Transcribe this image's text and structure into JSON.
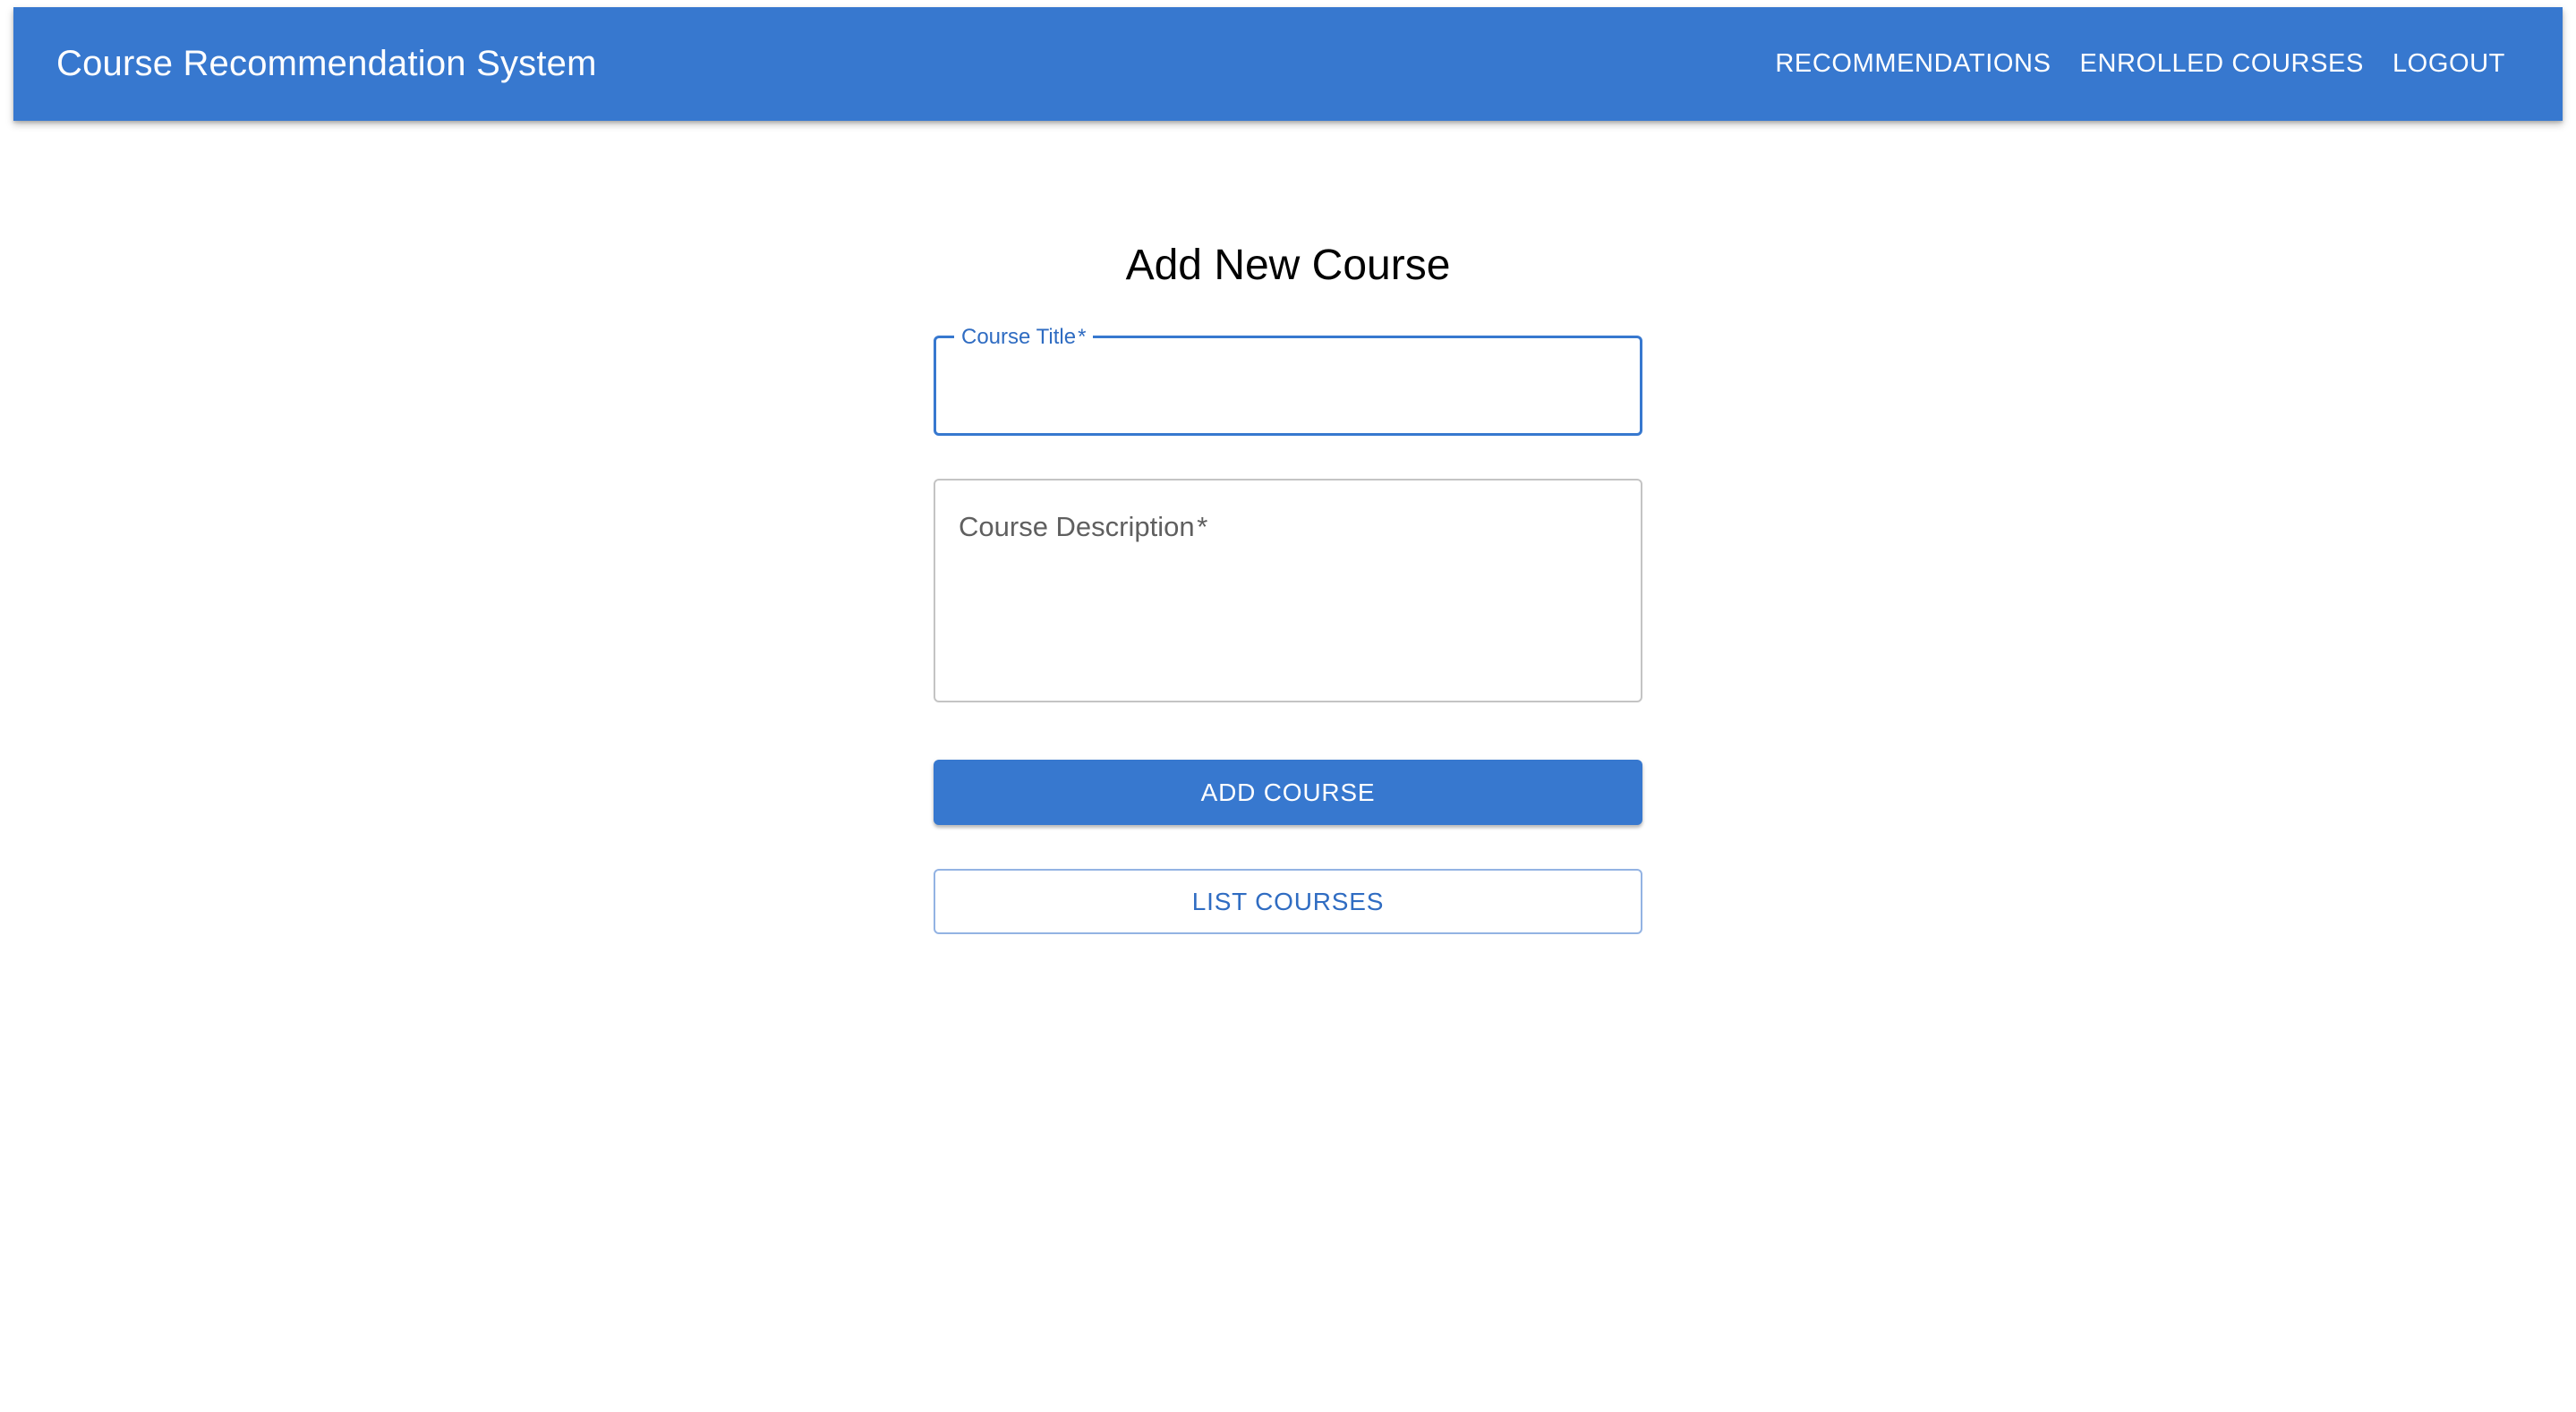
{
  "appbar": {
    "title": "Course Recommendation System",
    "nav": [
      {
        "label": "RECOMMENDATIONS"
      },
      {
        "label": "ENROLLED COURSES"
      },
      {
        "label": "LOGOUT"
      }
    ]
  },
  "form": {
    "heading": "Add New Course",
    "title_field": {
      "label": "Course Title",
      "required_mark": "*",
      "value": ""
    },
    "description_field": {
      "label": "Course Description",
      "required_mark": "*",
      "value": ""
    },
    "add_button_label": "ADD COURSE",
    "list_button_label": "LIST COURSES"
  },
  "colors": {
    "primary": "#3778cf",
    "primary_text": "#2f6cc2",
    "outline_border": "#93b3e3",
    "field_border": "#c4c4c4"
  }
}
